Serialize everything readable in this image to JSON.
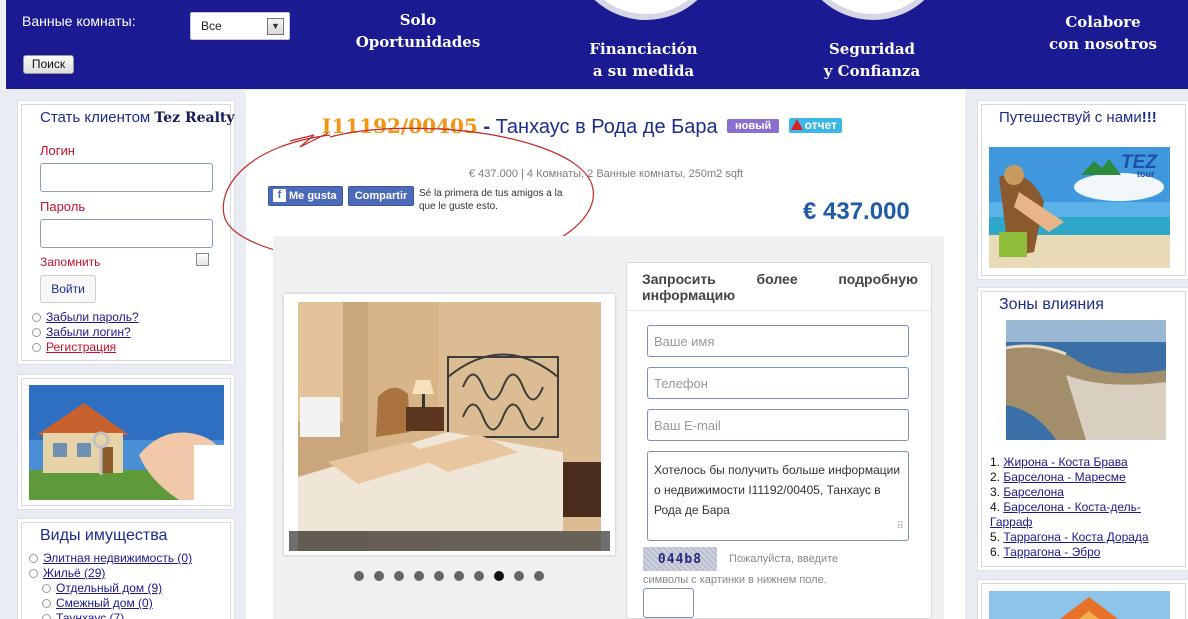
{
  "header": {
    "bathrooms_label": "Ванные комнаты:",
    "bathrooms_select": "Все",
    "search_button": "Поиск",
    "nav": [
      {
        "line1": "Solo",
        "line2": "Oportunidades"
      },
      {
        "line1": "Financiación",
        "line2": "a su medida"
      },
      {
        "line1": "Seguridad",
        "line2": "y Confianza"
      },
      {
        "line1": "Colabore",
        "line2": "con nosotros"
      }
    ]
  },
  "login": {
    "title_prefix": "Стать клиентом",
    "title_brand": "Tez Realty",
    "login_label": "Логин",
    "password_label": "Пароль",
    "remember_label": "Запомнить",
    "submit": "Войти",
    "links": [
      "Забыли пароль?",
      "Забыли логин?",
      "Регистрация"
    ]
  },
  "property_types": {
    "title": "Виды имущества",
    "items": [
      {
        "label": "Элитная недвижимость (0)",
        "level": 0
      },
      {
        "label": "Жильё (29)",
        "level": 0
      },
      {
        "label": "Отдельный дом (9)",
        "level": 1
      },
      {
        "label": "Смежный дом (0)",
        "level": 1
      },
      {
        "label": "Таунхаус (7)",
        "level": 1
      }
    ]
  },
  "listing": {
    "ref": "I11192/00405",
    "separator": " - ",
    "title": "Танхаус в Рода де Бара",
    "badge_new": "новый",
    "badge_report": "отчет",
    "subinfo": "€ 437.000 | 4 Комнаты, 2 Ванные комнаты, 250m2 sqft",
    "price": "€ 437.000",
    "fb_like": "Me gusta",
    "fb_share": "Compartir",
    "fb_text": "Sé la primera de tus amigos a la que le guste esto.",
    "gallery_dots": 10,
    "gallery_active": 7
  },
  "inquiry": {
    "title": "Запросить более подробную информацию",
    "name_placeholder": "Ваше имя",
    "phone_placeholder": "Телефон",
    "email_placeholder": "Ваш E-mail",
    "message": "Хотелось бы получить больше информации о недвижимости I11192/00405, Танхаус в Рода де Бара",
    "captcha_code": "044b8",
    "captcha_hint": "Пожалуйста, введите символы с картинки в нижнем поле."
  },
  "travel": {
    "title_main": "Путешествуй с нами",
    "title_bang": "!!!",
    "logo_text": "TEZ",
    "logo_sub": "tour"
  },
  "zones": {
    "title": "Зоны влияния",
    "items": [
      {
        "num": "1.",
        "label": "Жирона - Коста Брава"
      },
      {
        "num": "2.",
        "label": "Барселона - Маресме"
      },
      {
        "num": "3.",
        "label": "Барселона"
      },
      {
        "num": "4.",
        "label": "Барселона - Коста-дель-Гарраф"
      },
      {
        "num": "5.",
        "label": "Таррагона - Коста Дорада"
      },
      {
        "num": "6.",
        "label": "Таррагона - Эбро"
      }
    ]
  },
  "colors": {
    "header_blue": "#1b1a93",
    "ref_orange": "#f29512",
    "price_blue": "#1e5ba8",
    "login_red": "#c8102e",
    "annotation_red": "#c62828"
  }
}
